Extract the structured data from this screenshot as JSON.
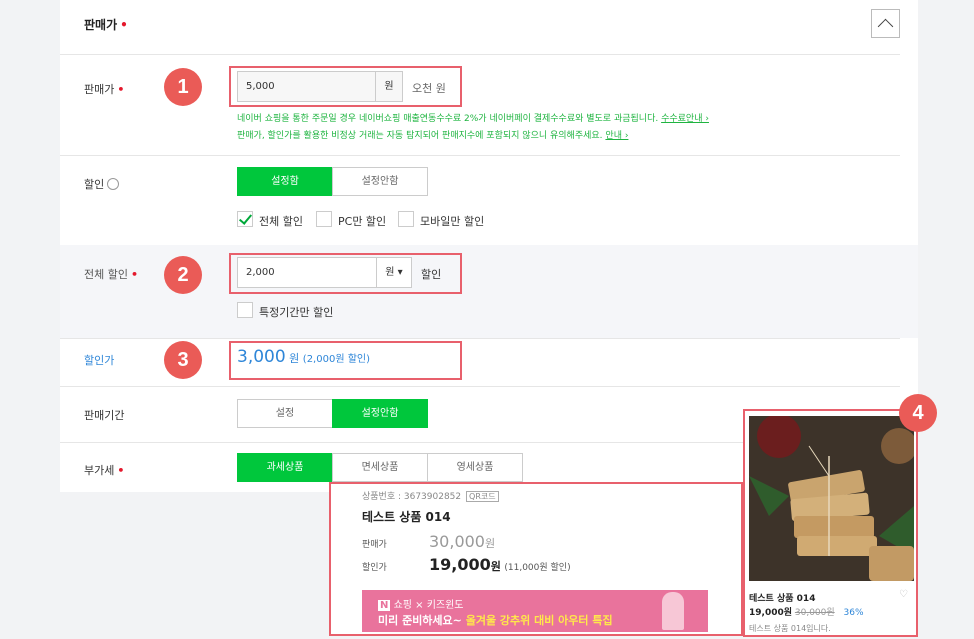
{
  "section": {
    "title": "판매가",
    "required_mark": "•"
  },
  "sale_price": {
    "label": "판매가",
    "value": "5,000",
    "unit": "원",
    "korean_text": "오천 원",
    "note1": "네이버 쇼핑을 통한 주문일 경우 네이버쇼핑 매출연동수수료 2%가 네이버페이 결제수수료와 별도로 과금됩니다.",
    "note1_link": "수수료안내 ›",
    "note2": "판매가, 할인가를 활용한 비정상 거래는 자동 탐지되어 판매지수에 포함되지 않으니 유의해주세요.",
    "note2_link": "안내 ›"
  },
  "discount": {
    "label": "할인",
    "on_label": "설정함",
    "off_label": "설정안함",
    "options": [
      "전체 할인",
      "PC만 할인",
      "모바일만 할인"
    ]
  },
  "total_discount": {
    "label": "전체 할인",
    "value": "2,000",
    "unit": "원 ▾",
    "suffix": "할인",
    "period_label": "특정기간만 할인"
  },
  "discount_price": {
    "label": "할인가",
    "value": "3,000",
    "unit": "원",
    "detail": "(2,000원 할인)"
  },
  "sale_period": {
    "label": "판매기간",
    "on_label": "설정",
    "off_label": "설정안함"
  },
  "vat": {
    "label": "부가세",
    "options": [
      "과세상품",
      "면세상품",
      "영세상품"
    ]
  },
  "badges": [
    "1",
    "2",
    "3",
    "4"
  ],
  "preview": {
    "product_no": "상품번호 : 3673902852",
    "qr": "QR코드",
    "name": "테스트 상품 014",
    "price_label": "판매가",
    "price": "30,000",
    "price_unit": "원",
    "discount_label": "할인가",
    "discount_price": "19,000",
    "discount_unit": "원",
    "discount_detail": "(11,000원 할인)",
    "banner_tag": "N",
    "banner_line1": "쇼핑 × 키즈윈도",
    "banner_line2a": "미리 준비하세요~",
    "banner_line2b": "올겨울 강추위 대비 아우터 특집"
  },
  "side": {
    "name": "테스트 상품 014",
    "price": "19,000원",
    "old_price": "30,000원",
    "percent": "36%",
    "desc": "테스트 상품 014입니다."
  },
  "colors": {
    "green": "#00c73c",
    "blue": "#2e86d8",
    "red_box": "#e8606c",
    "badge": "#ea5b57"
  }
}
